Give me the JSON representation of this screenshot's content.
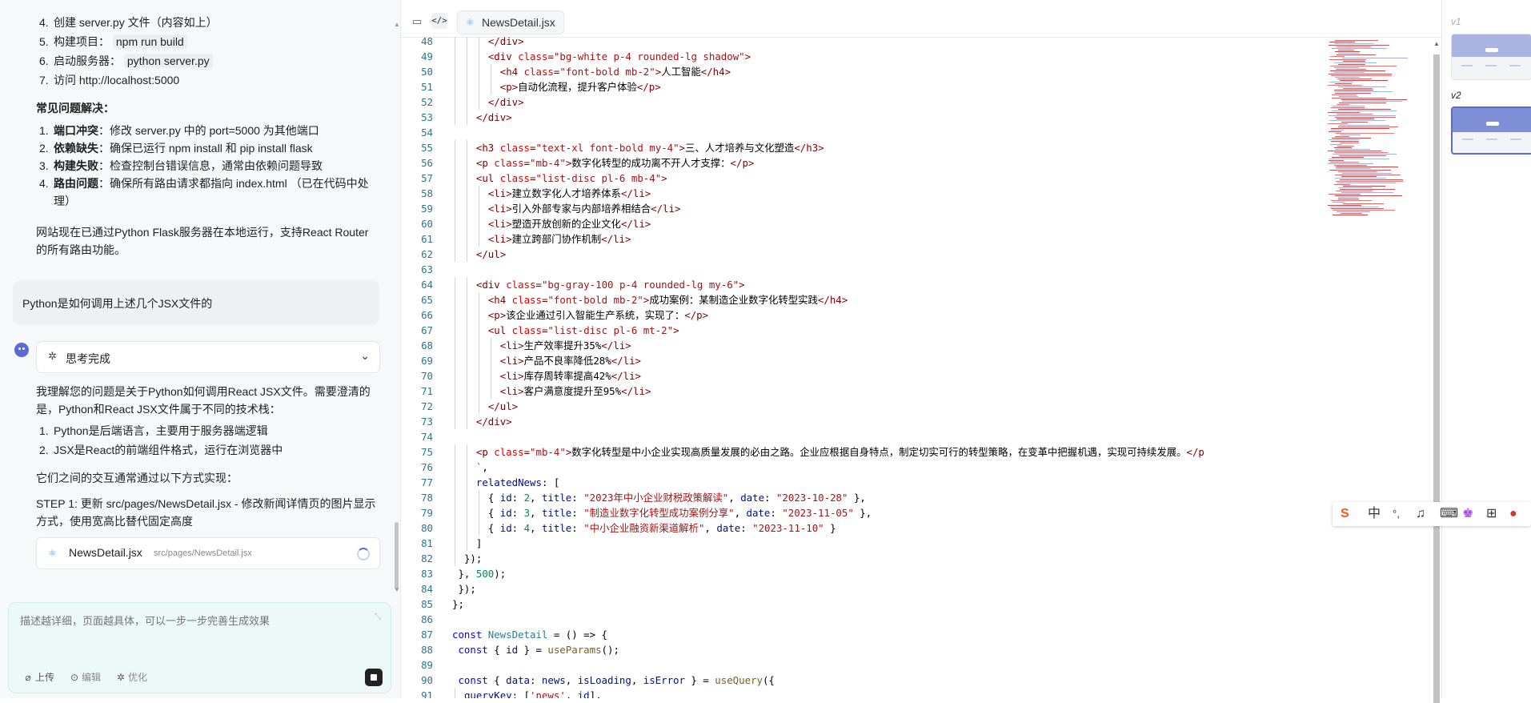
{
  "chat": {
    "steps_top": [
      {
        "n": "4.",
        "text": "创建 server.py 文件（内容如上）"
      },
      {
        "n": "5.",
        "text": "构建项目：",
        "code": "npm run build"
      },
      {
        "n": "6.",
        "text": "启动服务器：",
        "code": "python server.py"
      },
      {
        "n": "7.",
        "text": "访问 http://localhost:5000"
      }
    ],
    "faq_heading": "常见问题解决：",
    "faq": [
      {
        "n": "1.",
        "label": "端口冲突",
        "text": "：修改 server.py 中的 port=5000 为其他端口"
      },
      {
        "n": "2.",
        "label": "依赖缺失",
        "text": "：确保已运行 npm install 和 pip install flask"
      },
      {
        "n": "3.",
        "label": "构建失败",
        "text": "：检查控制台错误信息，通常由依赖问题导致"
      },
      {
        "n": "4.",
        "label": "路由问题",
        "text": "：确保所有路由请求都指向 index.html （已在代码中处理）"
      }
    ],
    "summary": "网站现在已通过Python Flask服务器在本地运行，支持React Router的所有路由功能。",
    "user_message": "Python是如何调用上述几个JSX文件的",
    "thinking_label": "思考完成",
    "answer_intro": "我理解您的问题是关于Python如何调用React JSX文件。需要澄清的是，Python和React JSX文件属于不同的技术栈：",
    "answer_points": [
      {
        "n": "1.",
        "text": "Python是后端语言，主要用于服务器端逻辑"
      },
      {
        "n": "2.",
        "text": "JSX是React的前端组件格式，运行在浏览器中"
      }
    ],
    "interaction": "它们之间的交互通常通过以下方式实现：",
    "step1": "STEP 1: 更新 src/pages/NewsDetail.jsx - 修改新闻详情页的图片显示方式，使用宽高比替代固定高度",
    "file_card": {
      "name": "NewsDetail.jsx",
      "path": "src/pages/NewsDetail.jsx"
    },
    "composer": {
      "placeholder": "描述越详细，页面越具体，可以一步一步完善生成效果",
      "upload": "上传",
      "edit": "编辑",
      "optimize": "优化"
    }
  },
  "editor": {
    "tab_file": "NewsDetail.jsx",
    "lines": [
      {
        "n": 48,
        "ind": 6,
        "h": [
          [
            "t",
            "</div>"
          ]
        ]
      },
      {
        "n": 49,
        "ind": 6,
        "h": [
          [
            "t",
            "<div "
          ],
          [
            "a",
            "class"
          ],
          [
            "t",
            "="
          ],
          [
            "s",
            "\"bg-white p-4 rounded-lg shadow\""
          ],
          [
            "t",
            ">"
          ]
        ]
      },
      {
        "n": 50,
        "ind": 8,
        "h": [
          [
            "t",
            "<h4 "
          ],
          [
            "a",
            "class"
          ],
          [
            "t",
            "="
          ],
          [
            "s",
            "\"font-bold mb-2\""
          ],
          [
            "t",
            ">"
          ],
          [
            "x",
            "人工智能"
          ],
          [
            "t",
            "</h4>"
          ]
        ]
      },
      {
        "n": 51,
        "ind": 8,
        "h": [
          [
            "t",
            "<p>"
          ],
          [
            "x",
            "自动化流程，提升客户体验"
          ],
          [
            "t",
            "</p>"
          ]
        ]
      },
      {
        "n": 52,
        "ind": 6,
        "h": [
          [
            "t",
            "</div>"
          ]
        ]
      },
      {
        "n": 53,
        "ind": 4,
        "h": [
          [
            "t",
            "</div>"
          ]
        ]
      },
      {
        "n": 54,
        "ind": 0,
        "h": []
      },
      {
        "n": 55,
        "ind": 4,
        "h": [
          [
            "t",
            "<h3 "
          ],
          [
            "a",
            "class"
          ],
          [
            "t",
            "="
          ],
          [
            "s",
            "\"text-xl font-bold my-4\""
          ],
          [
            "t",
            ">"
          ],
          [
            "x",
            "三、人才培养与文化塑造"
          ],
          [
            "t",
            "</h3>"
          ]
        ]
      },
      {
        "n": 56,
        "ind": 4,
        "h": [
          [
            "t",
            "<p "
          ],
          [
            "a",
            "class"
          ],
          [
            "t",
            "="
          ],
          [
            "s",
            "\"mb-4\""
          ],
          [
            "t",
            ">"
          ],
          [
            "x",
            "数字化转型的成功离不开人才支撑："
          ],
          [
            "t",
            "</p>"
          ]
        ]
      },
      {
        "n": 57,
        "ind": 4,
        "h": [
          [
            "t",
            "<ul "
          ],
          [
            "a",
            "class"
          ],
          [
            "t",
            "="
          ],
          [
            "s",
            "\"list-disc pl-6 mb-4\""
          ],
          [
            "t",
            ">"
          ]
        ]
      },
      {
        "n": 58,
        "ind": 6,
        "h": [
          [
            "t",
            "<li>"
          ],
          [
            "x",
            "建立数字化人才培养体系"
          ],
          [
            "t",
            "</li>"
          ]
        ]
      },
      {
        "n": 59,
        "ind": 6,
        "h": [
          [
            "t",
            "<li>"
          ],
          [
            "x",
            "引入外部专家与内部培养相结合"
          ],
          [
            "t",
            "</li>"
          ]
        ]
      },
      {
        "n": 60,
        "ind": 6,
        "h": [
          [
            "t",
            "<li>"
          ],
          [
            "x",
            "塑造开放创新的企业文化"
          ],
          [
            "t",
            "</li>"
          ]
        ]
      },
      {
        "n": 61,
        "ind": 6,
        "h": [
          [
            "t",
            "<li>"
          ],
          [
            "x",
            "建立跨部门协作机制"
          ],
          [
            "t",
            "</li>"
          ]
        ]
      },
      {
        "n": 62,
        "ind": 4,
        "h": [
          [
            "t",
            "</ul>"
          ]
        ]
      },
      {
        "n": 63,
        "ind": 0,
        "h": []
      },
      {
        "n": 64,
        "ind": 4,
        "h": [
          [
            "t",
            "<div "
          ],
          [
            "a",
            "class"
          ],
          [
            "t",
            "="
          ],
          [
            "s",
            "\"bg-gray-100 p-4 rounded-lg my-6\""
          ],
          [
            "t",
            ">"
          ]
        ]
      },
      {
        "n": 65,
        "ind": 6,
        "h": [
          [
            "t",
            "<h4 "
          ],
          [
            "a",
            "class"
          ],
          [
            "t",
            "="
          ],
          [
            "s",
            "\"font-bold mb-2\""
          ],
          [
            "t",
            ">"
          ],
          [
            "x",
            "成功案例：某制造企业数字化转型实践"
          ],
          [
            "t",
            "</h4>"
          ]
        ]
      },
      {
        "n": 66,
        "ind": 6,
        "h": [
          [
            "t",
            "<p>"
          ],
          [
            "x",
            "该企业通过引入智能生产系统，实现了："
          ],
          [
            "t",
            "</p>"
          ]
        ]
      },
      {
        "n": 67,
        "ind": 6,
        "h": [
          [
            "t",
            "<ul "
          ],
          [
            "a",
            "class"
          ],
          [
            "t",
            "="
          ],
          [
            "s",
            "\"list-disc pl-6 mt-2\""
          ],
          [
            "t",
            ">"
          ]
        ]
      },
      {
        "n": 68,
        "ind": 8,
        "h": [
          [
            "t",
            "<li>"
          ],
          [
            "x",
            "生产效率提升35%"
          ],
          [
            "t",
            "</li>"
          ]
        ]
      },
      {
        "n": 69,
        "ind": 8,
        "h": [
          [
            "t",
            "<li>"
          ],
          [
            "x",
            "产品不良率降低28%"
          ],
          [
            "t",
            "</li>"
          ]
        ]
      },
      {
        "n": 70,
        "ind": 8,
        "h": [
          [
            "t",
            "<li>"
          ],
          [
            "x",
            "库存周转率提高42%"
          ],
          [
            "t",
            "</li>"
          ]
        ]
      },
      {
        "n": 71,
        "ind": 8,
        "h": [
          [
            "t",
            "<li>"
          ],
          [
            "x",
            "客户满意度提升至95%"
          ],
          [
            "t",
            "</li>"
          ]
        ]
      },
      {
        "n": 72,
        "ind": 6,
        "h": [
          [
            "t",
            "</ul>"
          ]
        ]
      },
      {
        "n": 73,
        "ind": 4,
        "h": [
          [
            "t",
            "</div>"
          ]
        ]
      },
      {
        "n": 74,
        "ind": 0,
        "h": []
      },
      {
        "n": 75,
        "ind": 4,
        "h": [
          [
            "t",
            "<p "
          ],
          [
            "a",
            "class"
          ],
          [
            "t",
            "="
          ],
          [
            "s",
            "\"mb-4\""
          ],
          [
            "t",
            ">"
          ],
          [
            "x",
            "数字化转型是中小企业实现高质量发展的必由之路。企业应根据自身特点，制定切实可行的转型策略，在变革中把握机遇，实现可持续发展。"
          ],
          [
            "t",
            "</p"
          ]
        ]
      },
      {
        "n": 76,
        "ind": 4,
        "h": [
          [
            "s",
            "`"
          ],
          [
            "p",
            ","
          ]
        ]
      },
      {
        "n": 77,
        "ind": 4,
        "h": [
          [
            "v",
            "relatedNews"
          ],
          [
            "p",
            ": ["
          ]
        ]
      },
      {
        "n": 78,
        "ind": 6,
        "h": [
          [
            "p",
            "{ "
          ],
          [
            "v",
            "id"
          ],
          [
            "p",
            ": "
          ],
          [
            "n",
            "2"
          ],
          [
            "p",
            ", "
          ],
          [
            "v",
            "title"
          ],
          [
            "p",
            ": "
          ],
          [
            "s",
            "\"2023年中小企业财税政策解读\""
          ],
          [
            "p",
            ", "
          ],
          [
            "v",
            "date"
          ],
          [
            "p",
            ": "
          ],
          [
            "s",
            "\"2023-10-28\""
          ],
          [
            "p",
            " },"
          ]
        ]
      },
      {
        "n": 79,
        "ind": 6,
        "h": [
          [
            "p",
            "{ "
          ],
          [
            "v",
            "id"
          ],
          [
            "p",
            ": "
          ],
          [
            "n",
            "3"
          ],
          [
            "p",
            ", "
          ],
          [
            "v",
            "title"
          ],
          [
            "p",
            ": "
          ],
          [
            "s",
            "\"制造业数字化转型成功案例分享\""
          ],
          [
            "p",
            ", "
          ],
          [
            "v",
            "date"
          ],
          [
            "p",
            ": "
          ],
          [
            "s",
            "\"2023-11-05\""
          ],
          [
            "p",
            " },"
          ]
        ]
      },
      {
        "n": 80,
        "ind": 6,
        "h": [
          [
            "p",
            "{ "
          ],
          [
            "v",
            "id"
          ],
          [
            "p",
            ": "
          ],
          [
            "n",
            "4"
          ],
          [
            "p",
            ", "
          ],
          [
            "v",
            "title"
          ],
          [
            "p",
            ": "
          ],
          [
            "s",
            "\"中小企业融资新渠道解析\""
          ],
          [
            "p",
            ", "
          ],
          [
            "v",
            "date"
          ],
          [
            "p",
            ": "
          ],
          [
            "s",
            "\"2023-11-10\""
          ],
          [
            "p",
            " }"
          ]
        ]
      },
      {
        "n": 81,
        "ind": 4,
        "h": [
          [
            "p",
            "]"
          ]
        ]
      },
      {
        "n": 82,
        "ind": 2,
        "h": [
          [
            "p",
            "});"
          ]
        ]
      },
      {
        "n": 83,
        "ind": 1,
        "h": [
          [
            "p",
            "}, "
          ],
          [
            "n",
            "500"
          ],
          [
            "p",
            ");"
          ]
        ]
      },
      {
        "n": 84,
        "ind": 0,
        "h": [
          [
            "p",
            " });"
          ]
        ]
      },
      {
        "n": 85,
        "ind": 0,
        "h": [
          [
            "p",
            "};"
          ]
        ]
      },
      {
        "n": 86,
        "ind": 0,
        "h": []
      },
      {
        "n": 87,
        "ind": 0,
        "h": [
          [
            "k",
            "const "
          ],
          [
            "c",
            "NewsDetail"
          ],
          [
            "p",
            " = () => {"
          ]
        ]
      },
      {
        "n": 88,
        "ind": 1,
        "h": [
          [
            "k",
            "const "
          ],
          [
            "p",
            "{ "
          ],
          [
            "v",
            "id"
          ],
          [
            "p",
            " } = "
          ],
          [
            "f",
            "useParams"
          ],
          [
            "p",
            "();"
          ]
        ]
      },
      {
        "n": 89,
        "ind": 0,
        "h": []
      },
      {
        "n": 90,
        "ind": 1,
        "h": [
          [
            "k",
            "const "
          ],
          [
            "p",
            "{ "
          ],
          [
            "v",
            "data"
          ],
          [
            "p",
            ": "
          ],
          [
            "v",
            "news"
          ],
          [
            "p",
            ", "
          ],
          [
            "v",
            "isLoading"
          ],
          [
            "p",
            ", "
          ],
          [
            "v",
            "isError"
          ],
          [
            "p",
            " } = "
          ],
          [
            "f",
            "useQuery"
          ],
          [
            "p",
            "({"
          ]
        ]
      },
      {
        "n": 91,
        "ind": 2,
        "h": [
          [
            "v",
            "queryKey"
          ],
          [
            "p",
            ": ["
          ],
          [
            "s",
            "'news'"
          ],
          [
            "p",
            ", "
          ],
          [
            "v",
            "id"
          ],
          [
            "p",
            "],"
          ]
        ]
      }
    ]
  },
  "versions": [
    {
      "label": "v1",
      "selected": false
    },
    {
      "label": "v2",
      "selected": true
    }
  ],
  "ime": {
    "items": [
      "中"
    ]
  },
  "colors": {
    "accent": "#5a6bd6",
    "composer_bg": "#edf9f7",
    "tag": "#800000",
    "attr": "#e50000",
    "string": "#a31515"
  }
}
